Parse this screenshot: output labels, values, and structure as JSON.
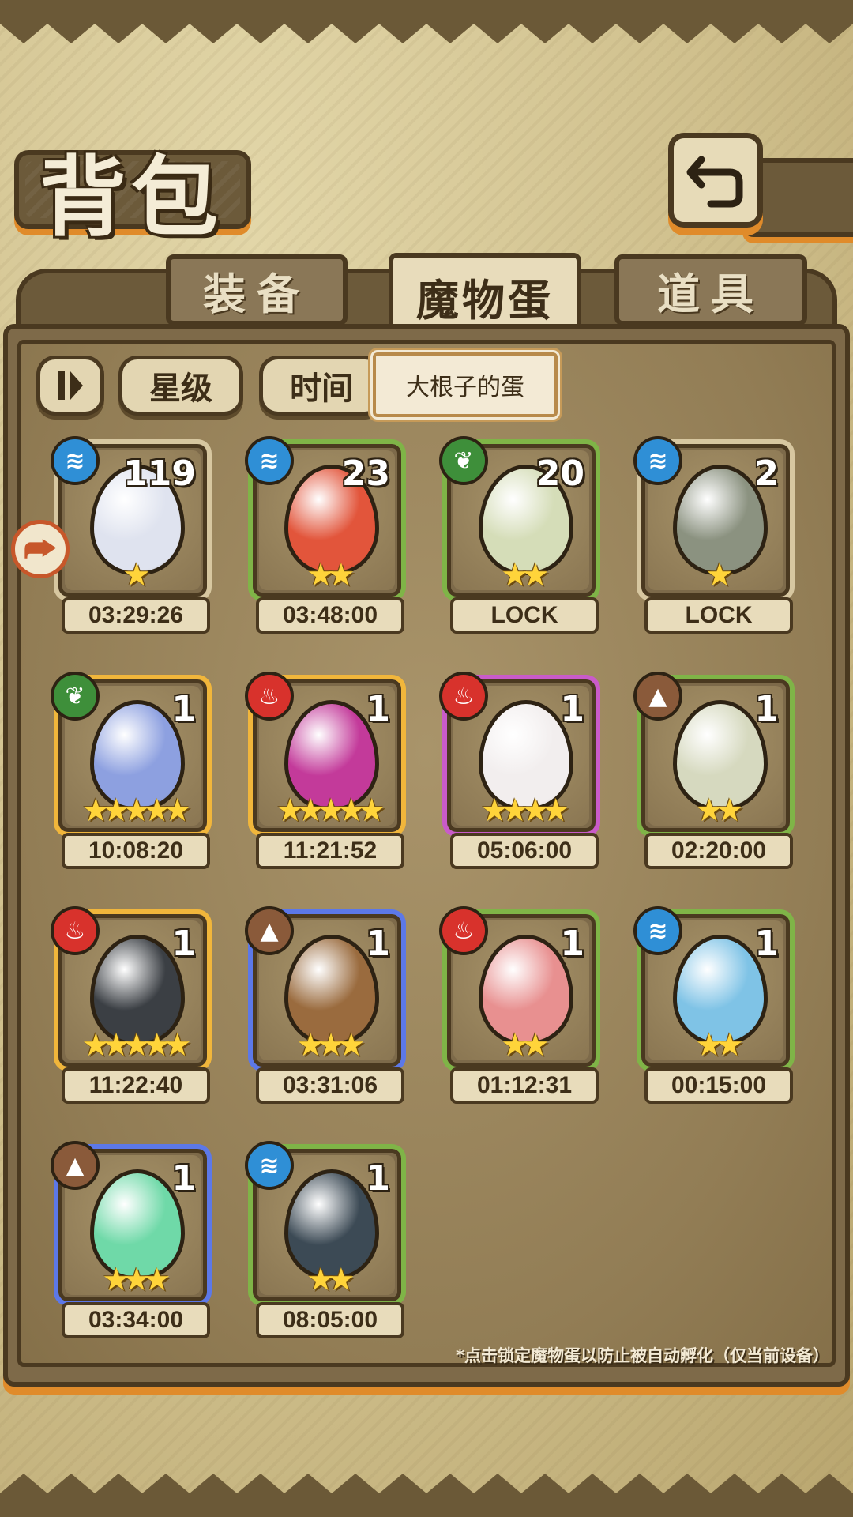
{
  "title": "背包",
  "tabs": [
    {
      "label": "装备",
      "active": false
    },
    {
      "label": "魔物蛋",
      "active": true
    },
    {
      "label": "道具",
      "active": false
    }
  ],
  "filters": {
    "toggle_icon": "pause-bars-icon",
    "star_label": "星级",
    "time_label": "时间",
    "tooltip": "大根子的蛋"
  },
  "eggs": [
    {
      "count": "119",
      "element": "water",
      "stars": 1,
      "timer": "03:29:26",
      "frame": "tan",
      "color": "#dfe3ef"
    },
    {
      "count": "23",
      "element": "water",
      "stars": 2,
      "timer": "03:48:00",
      "frame": "green",
      "color": "#e2553b"
    },
    {
      "count": "20",
      "element": "nature",
      "stars": 2,
      "timer": "LOCK",
      "frame": "green",
      "color": "#d5ddb8"
    },
    {
      "count": "2",
      "element": "water",
      "stars": 1,
      "timer": "LOCK",
      "frame": "tan",
      "color": "#8b9280"
    },
    {
      "count": "1",
      "element": "nature",
      "stars": 5,
      "timer": "10:08:20",
      "frame": "gold",
      "color": "#8da0e0"
    },
    {
      "count": "1",
      "element": "fire",
      "stars": 5,
      "timer": "11:21:52",
      "frame": "gold",
      "color": "#c33a9a"
    },
    {
      "count": "1",
      "element": "fire",
      "stars": 4,
      "timer": "05:06:00",
      "frame": "purple",
      "color": "#f2eeee"
    },
    {
      "count": "1",
      "element": "earth",
      "stars": 2,
      "timer": "02:20:00",
      "frame": "green",
      "color": "#d6d9bf"
    },
    {
      "count": "1",
      "element": "fire",
      "stars": 5,
      "timer": "11:22:40",
      "frame": "gold",
      "color": "#3b3f44"
    },
    {
      "count": "1",
      "element": "earth",
      "stars": 3,
      "timer": "03:31:06",
      "frame": "blue",
      "color": "#9a6b3e"
    },
    {
      "count": "1",
      "element": "fire",
      "stars": 2,
      "timer": "01:12:31",
      "frame": "green",
      "color": "#e89090"
    },
    {
      "count": "1",
      "element": "water",
      "stars": 2,
      "timer": "00:15:00",
      "frame": "green",
      "color": "#7fc3e6"
    },
    {
      "count": "1",
      "element": "earth",
      "stars": 3,
      "timer": "03:34:00",
      "frame": "blue",
      "color": "#6fd9a8"
    },
    {
      "count": "1",
      "element": "water",
      "stars": 2,
      "timer": "08:05:00",
      "frame": "green",
      "color": "#3c4a55"
    }
  ],
  "lock_badge_icon": "lock-toggle-icon",
  "hint": "*点击锁定魔物蛋以防止被自动孵化（仅当前设备）"
}
